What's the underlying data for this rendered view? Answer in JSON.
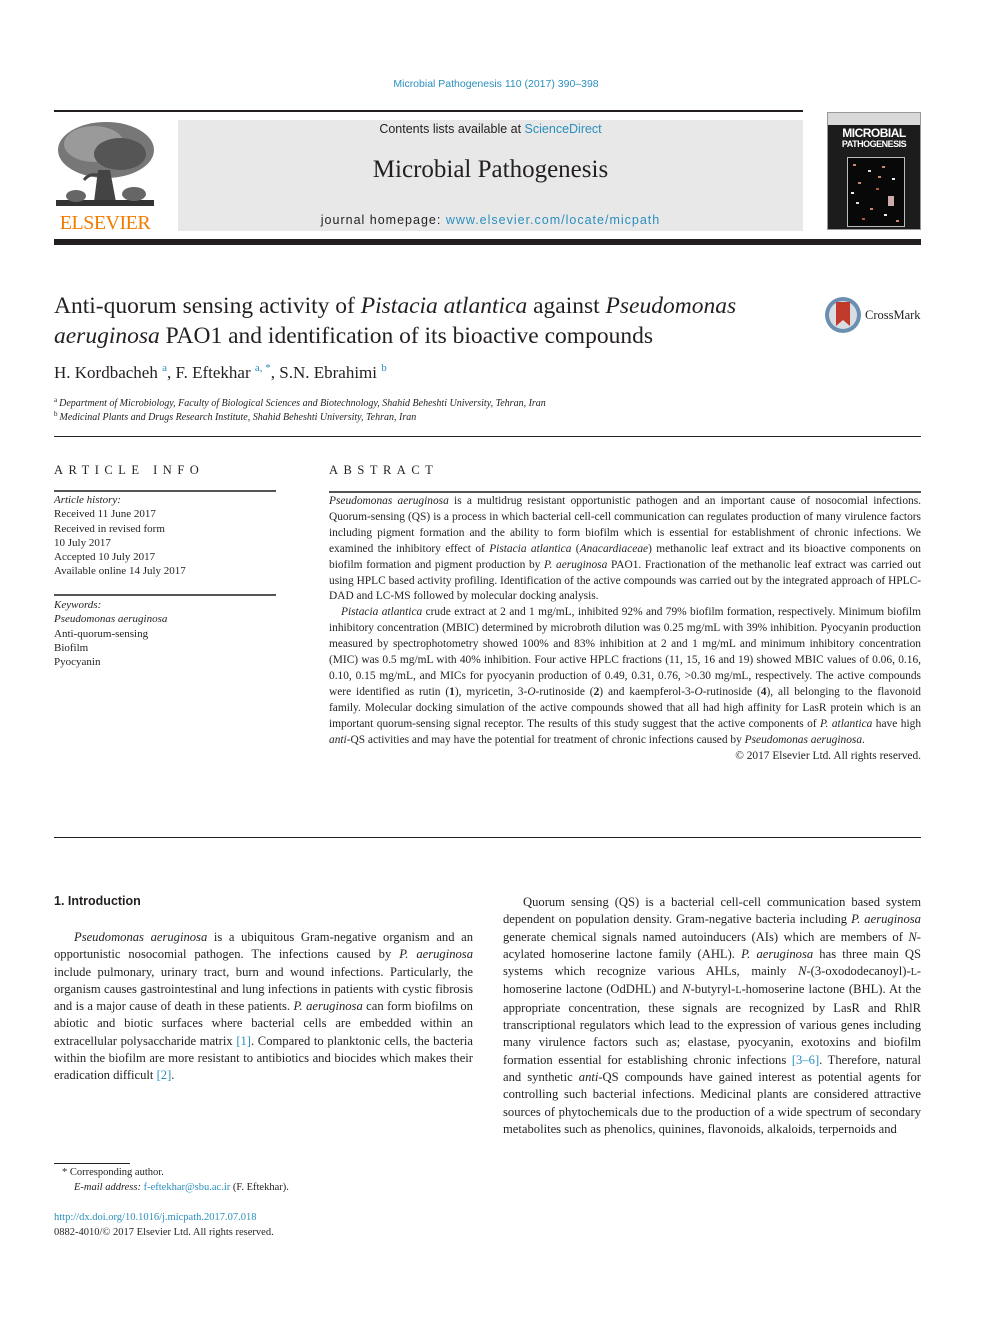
{
  "header": {
    "citation": "Microbial Pathogenesis 110 (2017) 390–398",
    "publisher_logo": "ELSEVIER",
    "contents_prefix": "Contents lists available at ",
    "contents_link": "ScienceDirect",
    "journal_name": "Microbial Pathogenesis",
    "homepage_prefix": "journal homepage: ",
    "homepage_link": "www.elsevier.com/locate/micpath",
    "cover_title_line1": "MICROBIAL",
    "cover_title_line2": "PATHOGENESIS",
    "crossmark_label": "CrossMark"
  },
  "article": {
    "title_parts": [
      "Anti-quorum sensing activity of ",
      "Pistacia atlantica",
      " against ",
      "Pseudomonas aeruginosa",
      " PAO1 and identification of its bioactive compounds"
    ],
    "authors": [
      {
        "name": "H. Kordbacheh",
        "sup": "a"
      },
      {
        "name": "F. Eftekhar",
        "sup": "a, *"
      },
      {
        "name": "S.N. Ebrahimi",
        "sup": "b"
      }
    ],
    "affiliations": [
      {
        "sup": "a",
        "text": "Department of Microbiology, Faculty of Biological Sciences and Biotechnology, Shahid Beheshti University, Tehran, Iran"
      },
      {
        "sup": "b",
        "text": "Medicinal Plants and Drugs Research Institute, Shahid Beheshti University, Tehran, Iran"
      }
    ]
  },
  "article_info": {
    "heading": "ARTICLE INFO",
    "history_label": "Article history:",
    "history": [
      "Received 11 June 2017",
      "Received in revised form",
      "10 July 2017",
      "Accepted 10 July 2017",
      "Available online 14 July 2017"
    ],
    "keywords_label": "Keywords:",
    "keywords": [
      "Pseudomonas aeruginosa",
      "Anti-quorum-sensing",
      "Biofilm",
      "Pyocyanin"
    ]
  },
  "abstract": {
    "heading": "ABSTRACT",
    "p1": [
      {
        "i": "Pseudomonas aeruginosa"
      },
      {
        "t": " is a multidrug resistant opportunistic pathogen and an important cause of nosocomial infections. Quorum-sensing (QS) is a process in which bacterial cell-cell communication can regulates production of many virulence factors including pigment formation and the ability to form biofilm which is essential for establishment of chronic infections. We examined the inhibitory effect of "
      },
      {
        "i": "Pistacia atlantica"
      },
      {
        "t": " ("
      },
      {
        "i": "Anacardiaceae"
      },
      {
        "t": ") methanolic leaf extract and its bioactive components on biofilm formation and pigment production by "
      },
      {
        "i": "P. aeruginosa"
      },
      {
        "t": " PAO1. Fractionation of the methanolic leaf extract was carried out using HPLC based activity profiling. Identification of the active compounds was carried out by the integrated approach of HPLC-DAD and LC-MS followed by molecular docking analysis."
      }
    ],
    "p2": [
      {
        "i": "Pistacia atlantica"
      },
      {
        "t": " crude extract at 2 and 1 mg/mL, inhibited 92% and 79% biofilm formation, respectively. Minimum biofilm inhibitory concentration (MBIC) determined by microbroth dilution was 0.25 mg/mL with 39% inhibition. Pyocyanin production measured by spectrophotometry showed 100% and 83% inhibition at 2 and 1 mg/mL and minimum inhibitory concentration (MIC) was 0.5 mg/mL with 40% inhibition. Four active HPLC fractions (11, 15, 16 and 19) showed MBIC values of 0.06, 0.16, 0.10, 0.15 mg/mL, and MICs for pyocyanin production of 0.49, 0.31, 0.76, >0.30 mg/mL, respectively. The active compounds were identified as rutin ("
      },
      {
        "b": "1"
      },
      {
        "t": "), myricetin, 3-"
      },
      {
        "i": "O"
      },
      {
        "t": "-rutinoside ("
      },
      {
        "b": "2"
      },
      {
        "t": ") and kaempferol-3-"
      },
      {
        "i": "O"
      },
      {
        "t": "-rutinoside ("
      },
      {
        "b": "4"
      },
      {
        "t": "), all belonging to the flavonoid family. Molecular docking simulation of the active compounds showed that all had high affinity for LasR protein which is an important quorum-sensing signal receptor. The results of this study suggest that the active components of "
      },
      {
        "i": "P. atlantica"
      },
      {
        "t": " have high "
      },
      {
        "i": "anti"
      },
      {
        "t": "-QS activities and may have the potential for treatment of chronic infections caused by "
      },
      {
        "i": "Pseudomonas aeruginosa"
      },
      {
        "t": "."
      }
    ],
    "copyright": "© 2017 Elsevier Ltd. All rights reserved."
  },
  "introduction": {
    "heading": "1.  Introduction",
    "left_p": [
      {
        "i": "Pseudomonas aeruginosa"
      },
      {
        "t": " is a ubiquitous Gram-negative organism and an opportunistic nosocomial pathogen. The infections caused by "
      },
      {
        "i": "P. aeruginosa"
      },
      {
        "t": " include pulmonary, urinary tract, burn and wound infections. Particularly, the organism causes gastrointestinal and lung infections in patients with cystic fibrosis and is a major cause of death in these patients. "
      },
      {
        "i": "P. aeruginosa"
      },
      {
        "t": " can form biofilms on abiotic and biotic surfaces where bacterial cells are embedded within an extracellular polysaccharide matrix "
      },
      {
        "ref": "[1]"
      },
      {
        "t": ". Compared to planktonic cells, the bacteria within the biofilm are more resistant to antibiotics and biocides which makes their eradication difficult "
      },
      {
        "ref": "[2]"
      },
      {
        "t": "."
      }
    ],
    "right_p": [
      {
        "t": "Quorum sensing (QS) is a bacterial cell-cell communication based system dependent on population density. Gram-negative bacteria including "
      },
      {
        "i": "P. aeruginosa"
      },
      {
        "t": " generate chemical signals named autoinducers (AIs) which are members of "
      },
      {
        "i": "N"
      },
      {
        "t": "-acylated homoserine lactone family (AHL). "
      },
      {
        "i": "P. aeruginosa"
      },
      {
        "t": " has three main QS systems which recognize various AHLs, mainly "
      },
      {
        "i": "N"
      },
      {
        "t": "-(3-oxododecanoyl)-"
      },
      {
        "sc": "l"
      },
      {
        "t": "-homoserine lactone (OdDHL) and "
      },
      {
        "i": "N"
      },
      {
        "t": "-butyryl-"
      },
      {
        "sc": "l"
      },
      {
        "t": "-homoserine lactone (BHL). At the appropriate concentration, these signals are recognized by LasR and RhlR transcriptional regulators which lead to the expression of various genes including many virulence factors such as; elastase, pyocyanin, exotoxins and biofilm formation essential for establishing chronic infections "
      },
      {
        "ref": "[3–6]"
      },
      {
        "t": ". Therefore, natural and synthetic "
      },
      {
        "i": "anti"
      },
      {
        "t": "-QS compounds have gained interest as potential agents for controlling such bacterial infections. Medicinal plants are considered attractive sources of phytochemicals due to the production of a wide spectrum of secondary metabolites such as phenolics, quinines, flavonoids, alkaloids, terpernoids and"
      }
    ]
  },
  "footnotes": {
    "corresponding": "* Corresponding author.",
    "email_label": "E-mail address: ",
    "email": "f-eftekhar@sbu.ac.ir",
    "email_suffix": " (F. Eftekhar).",
    "doi": "http://dx.doi.org/10.1016/j.micpath.2017.07.018",
    "issn": "0882-4010/© 2017 Elsevier Ltd. All rights reserved."
  },
  "colors": {
    "link": "#2a8fbd",
    "elsevier_orange": "#f07c00",
    "banner_gray": "#e8e8e8",
    "text": "#231f20"
  }
}
